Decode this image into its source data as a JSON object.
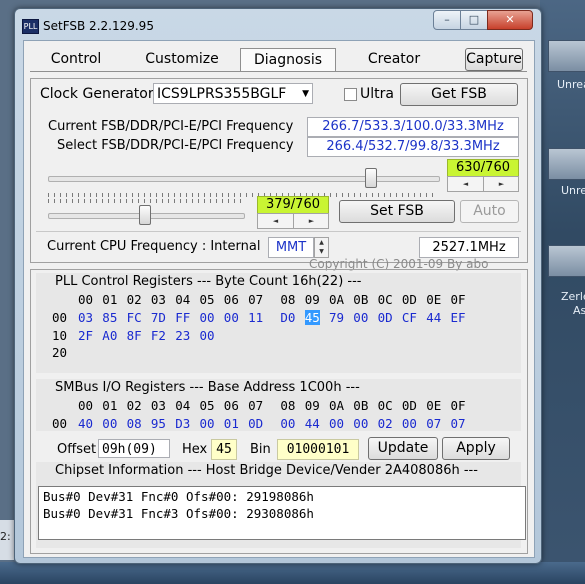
{
  "window": {
    "title": "SetFSB 2.2.129.95",
    "icon_text": "PLL"
  },
  "title_buttons": {
    "minimize": "–",
    "maximize": "□",
    "close": "✕"
  },
  "tabs": [
    {
      "label": "Control"
    },
    {
      "label": "Customize"
    },
    {
      "label": "Diagnosis"
    },
    {
      "label": "Creator"
    }
  ],
  "capture_label": "Capture",
  "clock": {
    "label": "Clock Generator",
    "value": "ICS9LPRS355BGLF",
    "ultra_label": "Ultra",
    "ultra_checked": false,
    "get_fsb_label": "Get FSB"
  },
  "freq": {
    "current_label": "Current FSB/DDR/PCI-E/PCI Frequency",
    "current_value": "266.7/533.3/100.0/33.3MHz",
    "select_label": "Select FSB/DDR/PCI-E/PCI Frequency",
    "select_value": "266.4/532.7/99.8/33.3MHz"
  },
  "slider1": {
    "readout": "630/760",
    "level": 0.8289
  },
  "slider2": {
    "readout": "379/760",
    "level": 0.4987
  },
  "set_fsb_label": "Set FSB",
  "auto_label": "Auto",
  "cpu": {
    "label": "Current CPU Frequency : Internal",
    "mmt": "MMT",
    "value": "2527.1MHz"
  },
  "copyright": "Copyright (C) 2001-09 By abo",
  "pll": {
    "header": "PLL Control Registers  --- Byte Count 16h(22) ---",
    "columns": [
      "00",
      "01",
      "02",
      "03",
      "04",
      "05",
      "06",
      "07",
      "08",
      "09",
      "0A",
      "0B",
      "0C",
      "0D",
      "0E",
      "0F"
    ],
    "rows": [
      {
        "addr": "00",
        "cells": [
          "03",
          "85",
          "FC",
          "7D",
          "FF",
          "00",
          "00",
          "11",
          "D0",
          "45",
          "79",
          "00",
          "0D",
          "CF",
          "44",
          "EF"
        ]
      },
      {
        "addr": "10",
        "cells": [
          "2F",
          "A0",
          "8F",
          "F2",
          "23",
          "00"
        ]
      },
      {
        "addr": "20",
        "cells": []
      }
    ],
    "selected": "09"
  },
  "smbus": {
    "header": "SMBus I/O Registers  --- Base Address 1C00h ---",
    "columns": [
      "00",
      "01",
      "02",
      "03",
      "04",
      "05",
      "06",
      "07",
      "08",
      "09",
      "0A",
      "0B",
      "0C",
      "0D",
      "0E",
      "0F"
    ],
    "rows": [
      {
        "addr": "00",
        "cells": [
          "40",
          "00",
          "08",
          "95",
          "D3",
          "00",
          "01",
          "0D",
          "00",
          "44",
          "00",
          "00",
          "02",
          "00",
          "07",
          "07"
        ]
      }
    ]
  },
  "edit": {
    "offset_label": "Offset",
    "offset_value": "09h(09)",
    "hex_label": "Hex",
    "hex_value": "45",
    "bin_label": "Bin",
    "bin_value": "01000101",
    "update_label": "Update",
    "apply_label": "Apply"
  },
  "chipset": {
    "header": "Chipset Information  --- Host Bridge Device/Vender 2A408086h ---",
    "lines": [
      "Bus#0 Dev#31 Fnc#0 Ofs#00: 29198086h",
      "Bus#0 Dev#31 Fnc#3 Ofs#00: 29308086h"
    ]
  },
  "desktop": {
    "items": [
      "Unrea",
      "Unrea",
      "Zerle",
      "As"
    ],
    "left_partial": "2:"
  }
}
